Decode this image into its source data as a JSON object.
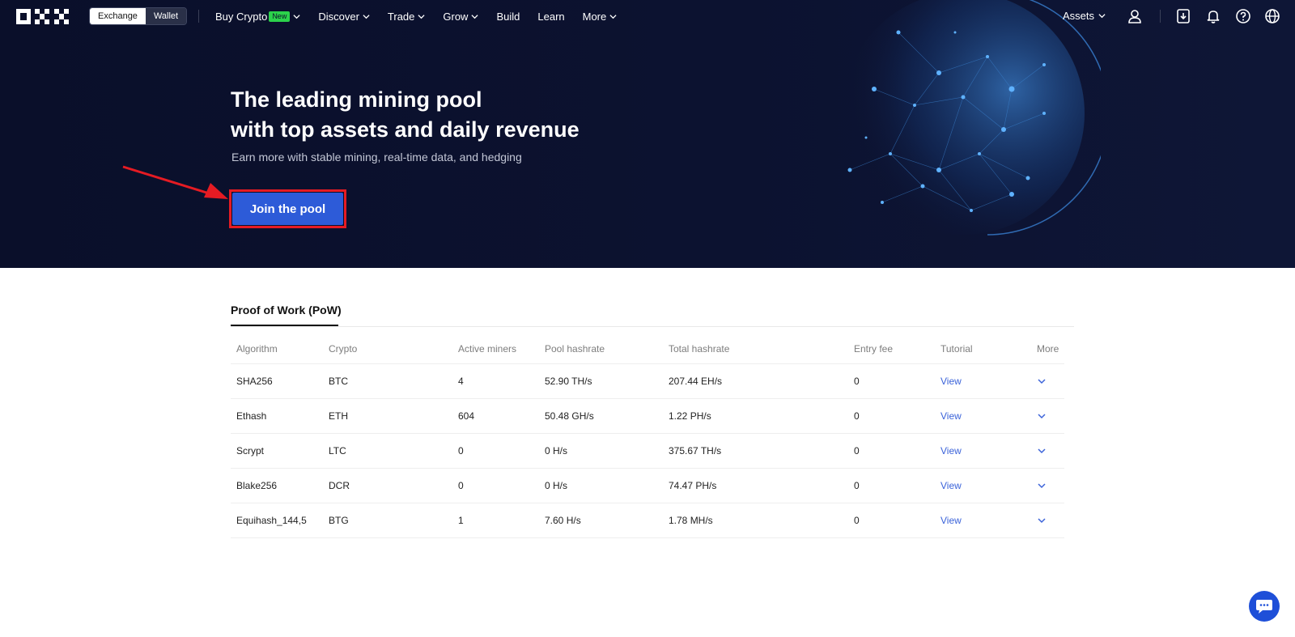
{
  "nav": {
    "switcher": {
      "exchange": "Exchange",
      "wallet": "Wallet"
    },
    "menu": [
      {
        "label": "Buy Crypto",
        "badge": "New",
        "has_dropdown": true
      },
      {
        "label": "Discover",
        "has_dropdown": true
      },
      {
        "label": "Trade",
        "has_dropdown": true
      },
      {
        "label": "Grow",
        "has_dropdown": true
      },
      {
        "label": "Build",
        "has_dropdown": false
      },
      {
        "label": "Learn",
        "has_dropdown": false
      },
      {
        "label": "More",
        "has_dropdown": true
      }
    ],
    "assets_label": "Assets",
    "icons": [
      "user-icon",
      "download-icon",
      "bell-icon",
      "help-icon",
      "globe-icon"
    ]
  },
  "hero": {
    "title_line1": "The leading mining pool",
    "title_line2": "with top assets and daily revenue",
    "subtitle": "Earn more with stable mining, real-time data, and hedging",
    "cta_label": "Join the pool"
  },
  "pool": {
    "tab_label": "Proof of Work (PoW)",
    "columns": [
      "Algorithm",
      "Crypto",
      "Active miners",
      "Pool hashrate",
      "Total hashrate",
      "Entry fee",
      "Tutorial",
      "More"
    ],
    "rows": [
      {
        "algorithm": "SHA256",
        "crypto": "BTC",
        "miners": "4",
        "pool_hashrate": "52.90 TH/s",
        "total_hashrate": "207.44 EH/s",
        "fee": "0",
        "tutorial": "View"
      },
      {
        "algorithm": "Ethash",
        "crypto": "ETH",
        "miners": "604",
        "pool_hashrate": "50.48 GH/s",
        "total_hashrate": "1.22 PH/s",
        "fee": "0",
        "tutorial": "View"
      },
      {
        "algorithm": "Scrypt",
        "crypto": "LTC",
        "miners": "0",
        "pool_hashrate": "0 H/s",
        "total_hashrate": "375.67 TH/s",
        "fee": "0",
        "tutorial": "View"
      },
      {
        "algorithm": "Blake256",
        "crypto": "DCR",
        "miners": "0",
        "pool_hashrate": "0 H/s",
        "total_hashrate": "74.47 PH/s",
        "fee": "0",
        "tutorial": "View"
      },
      {
        "algorithm": "Equihash_144,5",
        "crypto": "BTG",
        "miners": "1",
        "pool_hashrate": "7.60 H/s",
        "total_hashrate": "1.78 MH/s",
        "fee": "0",
        "tutorial": "View"
      }
    ]
  },
  "colors": {
    "hero_bg": "#0a0f2a",
    "cta_bg": "#2d5bd8",
    "highlight_red": "#e51b23",
    "link_blue": "#3b63d9",
    "new_badge": "#2bd24b"
  }
}
